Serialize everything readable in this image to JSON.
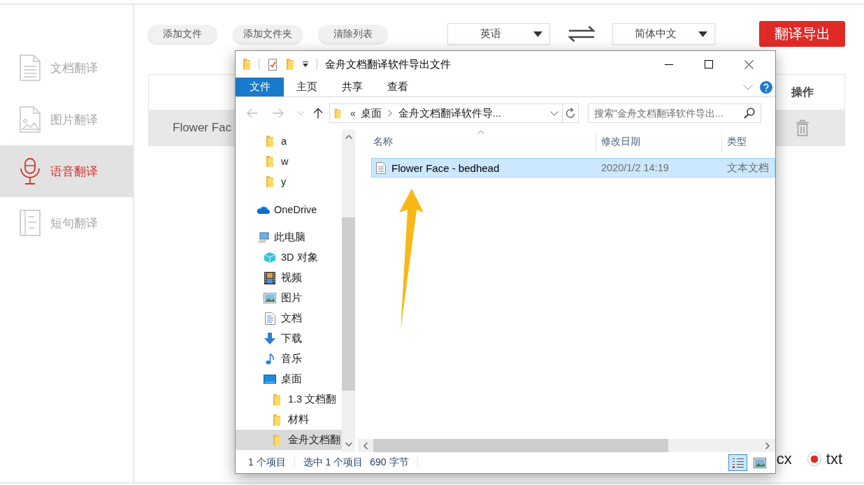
{
  "sidebar": {
    "items": [
      {
        "label": "文档翻译",
        "kind": "document",
        "selected": false
      },
      {
        "label": "图片翻译",
        "kind": "image",
        "selected": false
      },
      {
        "label": "语音翻译",
        "kind": "microphone",
        "selected": true
      },
      {
        "label": "短句翻译",
        "kind": "sentence",
        "selected": false
      }
    ]
  },
  "toolbar": {
    "buttons": [
      "添加文件",
      "添加文件夹",
      "清除列表"
    ],
    "source_language": "英语",
    "target_language": "简体中文",
    "export_button": "翻译导出"
  },
  "file_table": {
    "action_column": "操作",
    "rows": [
      {
        "name": "Flower Fac"
      }
    ]
  },
  "output_formats": [
    {
      "label": "cx"
    },
    {
      "label": "txt",
      "selected": true
    }
  ],
  "explorer": {
    "title": "金舟文档翻译软件导出文件",
    "ribbon_tabs": [
      {
        "label": "文件",
        "kind": "file_menu"
      },
      {
        "label": "主页",
        "kind": "tab"
      },
      {
        "label": "共享",
        "kind": "tab"
      },
      {
        "label": "查看",
        "kind": "tab"
      }
    ],
    "nav_buttons": [
      {
        "kind": "back",
        "disabled": true
      },
      {
        "kind": "forward",
        "disabled": true
      },
      {
        "kind": "recent",
        "disabled": true
      },
      {
        "kind": "up",
        "disabled": false
      }
    ],
    "address": {
      "overflow": "«",
      "segments": [
        "桌面",
        "金舟文档翻译软件导..."
      ]
    },
    "search": {
      "placeholder": "搜索\"金舟文档翻译软件导出..."
    },
    "pinned_folders": [
      {
        "label": "a",
        "kind": "folder",
        "selected": false
      },
      {
        "label": "w",
        "kind": "folder",
        "selected": false
      },
      {
        "label": "y",
        "kind": "folder",
        "selected": false
      }
    ],
    "nav_tree": [
      {
        "label": "OneDrive",
        "kind": "onedrive",
        "selected": false
      },
      {
        "label": "此电脑",
        "kind": "pc",
        "selected": false,
        "children": [
          {
            "label": "3D 对象",
            "kind": "objects3d",
            "selected": false
          },
          {
            "label": "视频",
            "kind": "videos",
            "selected": false
          },
          {
            "label": "图片",
            "kind": "pictures",
            "selected": false
          },
          {
            "label": "文档",
            "kind": "documents",
            "selected": false
          },
          {
            "label": "下载",
            "kind": "downloads",
            "selected": false
          },
          {
            "label": "音乐",
            "kind": "music",
            "selected": false
          },
          {
            "label": "桌面",
            "kind": "desktop",
            "selected": false,
            "children": [
              {
                "label": "1.3 文档翻",
                "kind": "folder",
                "selected": false
              },
              {
                "label": "材料",
                "kind": "folder",
                "selected": false
              },
              {
                "label": "金舟文档翻",
                "kind": "folder",
                "selected": true
              }
            ]
          }
        ]
      }
    ],
    "columns": [
      "名称",
      "修改日期",
      "类型"
    ],
    "files": [
      {
        "name": "Flower Face - bedhead",
        "modified": "2020/1/2 14:19",
        "type": "文本文档",
        "selected": true
      }
    ],
    "status": {
      "item_count": "1 个项目",
      "selection": "选中 1 个项目",
      "size": "690 字节"
    },
    "views": [
      {
        "kind": "details",
        "selected": true
      },
      {
        "kind": "large_icons",
        "selected": false
      }
    ]
  }
}
